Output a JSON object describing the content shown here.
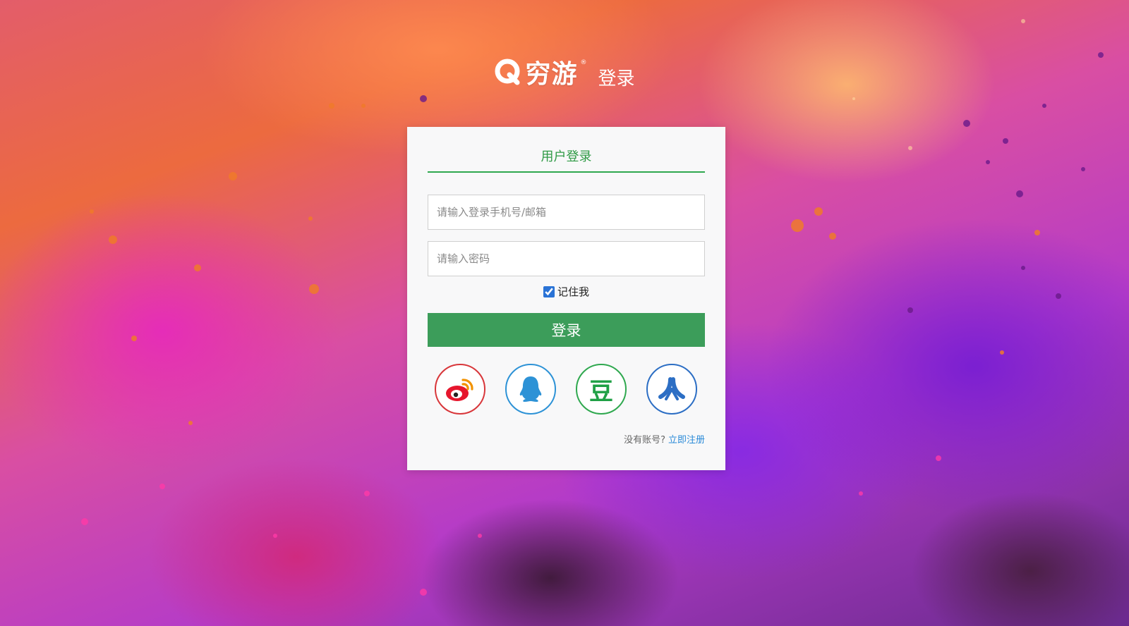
{
  "header": {
    "logo_text": "穷游",
    "logo_registered": "®",
    "page_title": "登录"
  },
  "login_panel": {
    "tab_label": "用户登录",
    "account_field": {
      "placeholder": "请输入登录手机号/邮箱",
      "value": ""
    },
    "password_field": {
      "placeholder": "请输入密码",
      "value": ""
    },
    "remember_me": {
      "label": "记住我",
      "checked": true
    },
    "submit_label": "登录",
    "social_logins": [
      {
        "name": "weibo",
        "icon": "weibo-icon",
        "color": "#d8363a"
      },
      {
        "name": "qq",
        "icon": "qq-penguin-icon",
        "color": "#2d92d6"
      },
      {
        "name": "douban",
        "icon": "douban-icon",
        "glyph": "豆",
        "color": "#2fa84f"
      },
      {
        "name": "renren",
        "icon": "renren-icon",
        "color": "#2c6ec4"
      }
    ],
    "register_prompt": "没有账号?",
    "register_link": "立即注册"
  },
  "colors": {
    "accent_green": "#3c9d5a",
    "tab_green": "#2f9a45",
    "link_blue": "#2a8ad8"
  }
}
